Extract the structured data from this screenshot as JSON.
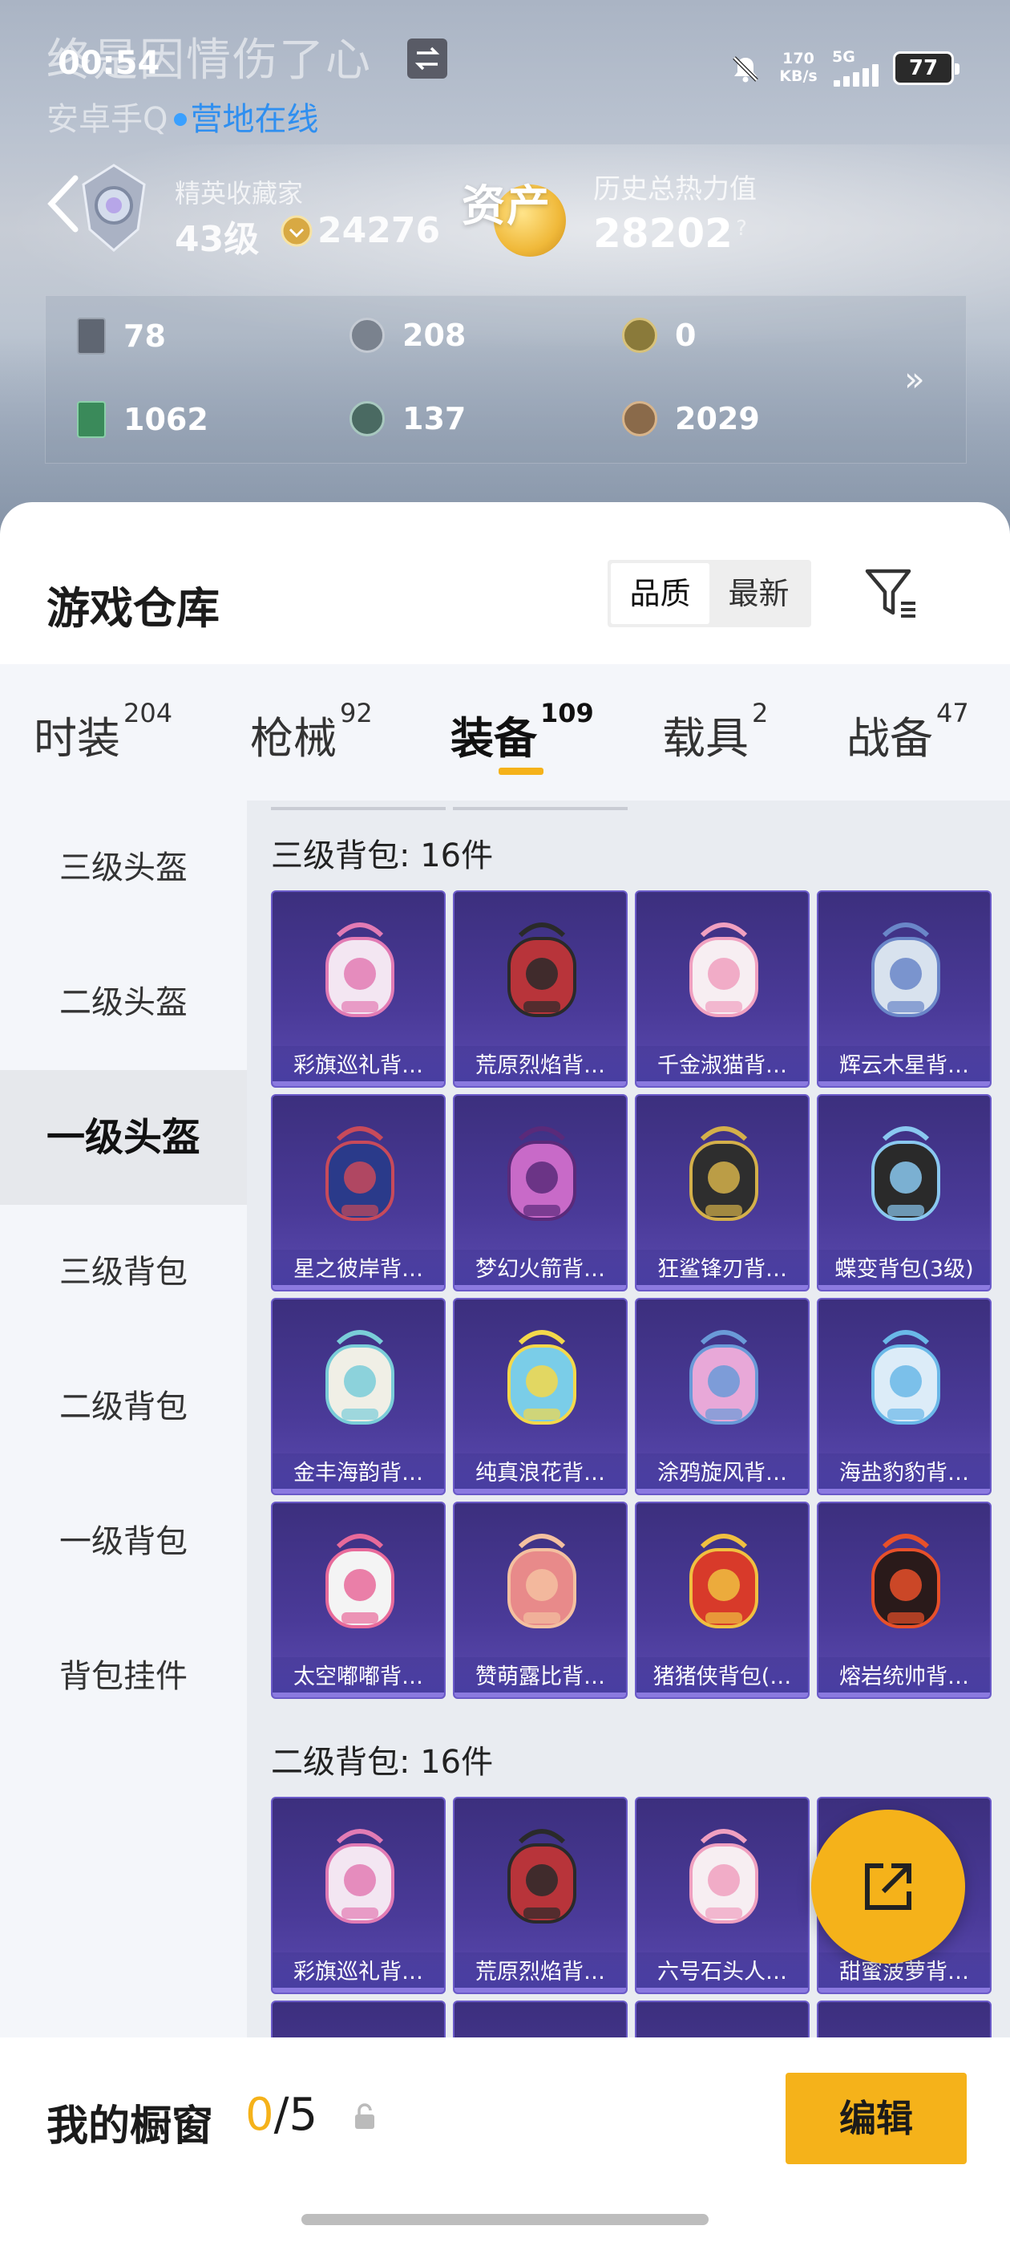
{
  "status_bar": {
    "time": "00:54",
    "speed_value": "170",
    "speed_unit": "KB/s",
    "network": "5G",
    "battery": "77"
  },
  "header": {
    "player_name": "终是因情伤了心",
    "platform": "安卓手Q",
    "online_status": "营地在线",
    "rank_title": "精英收藏家",
    "level": "43级",
    "coins": "24276",
    "assets_label": "资产",
    "heat_label": "历史总热力值",
    "heat_value": "28202",
    "help": "?"
  },
  "currencies": [
    {
      "icon": "card-gray-icon",
      "value": "78",
      "color": "#5f6672"
    },
    {
      "icon": "silver-coin-icon",
      "value": "208",
      "color": "#7a828e"
    },
    {
      "icon": "gold-medal-icon",
      "value": "0",
      "color": "#8a7a3a"
    },
    {
      "icon": "card-green-icon",
      "value": "1062",
      "color": "#3a8a5a"
    },
    {
      "icon": "green-coin-icon",
      "value": "137",
      "color": "#4a6a62"
    },
    {
      "icon": "bronze-coin-icon",
      "value": "2029",
      "color": "#8a6a4a"
    }
  ],
  "expand": "»",
  "warehouse": {
    "title": "游戏仓库",
    "sort_options": [
      "品质",
      "最新"
    ],
    "active_sort": "品质"
  },
  "tabs": [
    {
      "label": "时装",
      "count": "204"
    },
    {
      "label": "枪械",
      "count": "92"
    },
    {
      "label": "装备",
      "count": "109",
      "active": true
    },
    {
      "label": "载具",
      "count": "2"
    },
    {
      "label": "战备",
      "count": "47"
    }
  ],
  "left_nav": [
    {
      "label": "三级头盔"
    },
    {
      "label": "二级头盔"
    },
    {
      "label": "一级头盔",
      "active": true
    },
    {
      "label": "三级背包"
    },
    {
      "label": "二级背包"
    },
    {
      "label": "一级背包"
    },
    {
      "label": "背包挂件"
    }
  ],
  "sections": [
    {
      "title": "三级背包: 16件",
      "items": [
        "彩旗巡礼背…",
        "荒原烈焰背…",
        "千金淑猫背…",
        "辉云木星背…",
        "星之彼岸背…",
        "梦幻火箭背…",
        "狂鲨锋刃背…",
        "蝶变背包(3级)",
        "金丰海韵背…",
        "纯真浪花背…",
        "涂鸦旋风背…",
        "海盐豹豹背…",
        "太空嘟嘟背…",
        "赞萌露比背…",
        "猪猪侠背包(…",
        "熔岩统帅背…"
      ]
    },
    {
      "title": "二级背包: 16件",
      "items": [
        "彩旗巡礼背…",
        "荒原烈焰背…",
        "六号石头人…",
        "甜蜜菠萝背…"
      ]
    }
  ],
  "showcase": {
    "label": "我的橱窗",
    "used": "0",
    "total": "/5",
    "edit_label": "编辑"
  },
  "colors": {
    "accent": "#f5b21a",
    "item_bg": "#3c2f7e"
  }
}
